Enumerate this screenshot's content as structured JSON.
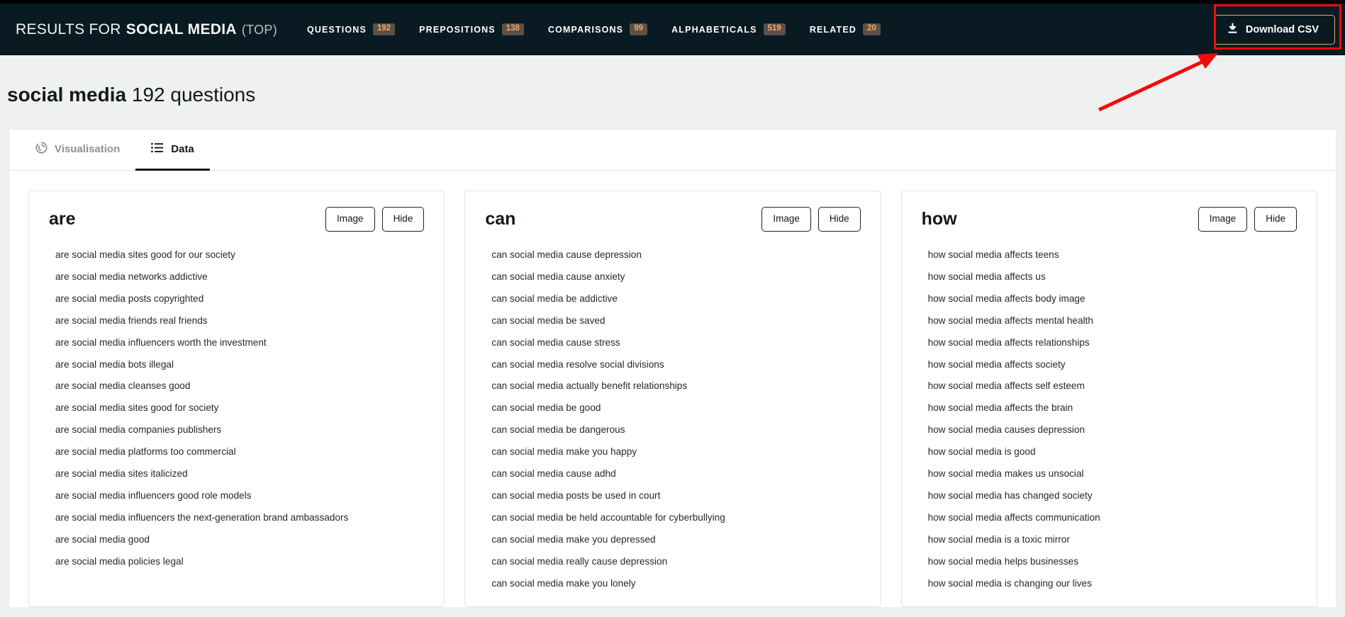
{
  "header": {
    "results_lead": "RESULTS FOR",
    "keyword": "SOCIAL MEDIA",
    "scope": "(TOP)",
    "nav": [
      {
        "label": "QUESTIONS",
        "badge": "192"
      },
      {
        "label": "PREPOSITIONS",
        "badge": "138"
      },
      {
        "label": "COMPARISONS",
        "badge": "99"
      },
      {
        "label": "ALPHABETICALS",
        "badge": "519"
      },
      {
        "label": "RELATED",
        "badge": "20"
      }
    ],
    "download_label": "Download CSV",
    "download_icon": "download-icon",
    "accent_orange": "#e8a868",
    "badge_bg": "#5b5148",
    "bar_bg": "#0a1a23",
    "annotation_color": "#f60a0a"
  },
  "page": {
    "title_keyword": "social media",
    "title_count": "192 questions"
  },
  "tabs": [
    {
      "label": "Visualisation",
      "icon": "donut-chart-icon",
      "active": false
    },
    {
      "label": "Data",
      "icon": "list-icon",
      "active": true
    }
  ],
  "card_buttons": {
    "image": "Image",
    "hide": "Hide"
  },
  "cards": [
    {
      "title": "are",
      "items": [
        "are social media sites good for our society",
        "are social media networks addictive",
        "are social media posts copyrighted",
        "are social media friends real friends",
        "are social media influencers worth the investment",
        "are social media bots illegal",
        "are social media cleanses good",
        "are social media sites good for society",
        "are social media companies publishers",
        "are social media platforms too commercial",
        "are social media sites italicized",
        "are social media influencers good role models",
        "are social media influencers the next-generation brand ambassadors",
        "are social media good",
        "are social media policies legal"
      ]
    },
    {
      "title": "can",
      "items": [
        "can social media cause depression",
        "can social media cause anxiety",
        "can social media be addictive",
        "can social media be saved",
        "can social media cause stress",
        "can social media resolve social divisions",
        "can social media actually benefit relationships",
        "can social media be good",
        "can social media be dangerous",
        "can social media make you happy",
        "can social media cause adhd",
        "can social media posts be used in court",
        "can social media be held accountable for cyberbullying",
        "can social media make you depressed",
        "can social media really cause depression",
        "can social media make you lonely"
      ]
    },
    {
      "title": "how",
      "items": [
        "how social media affects teens",
        "how social media affects us",
        "how social media affects body image",
        "how social media affects mental health",
        "how social media affects relationships",
        "how social media affects society",
        "how social media affects self esteem",
        "how social media affects the brain",
        "how social media causes depression",
        "how social media is good",
        "how social media makes us unsocial",
        "how social media has changed society",
        "how social media affects communication",
        "how social media is a toxic mirror",
        "how social media helps businesses",
        "how social media is changing our lives"
      ]
    }
  ]
}
